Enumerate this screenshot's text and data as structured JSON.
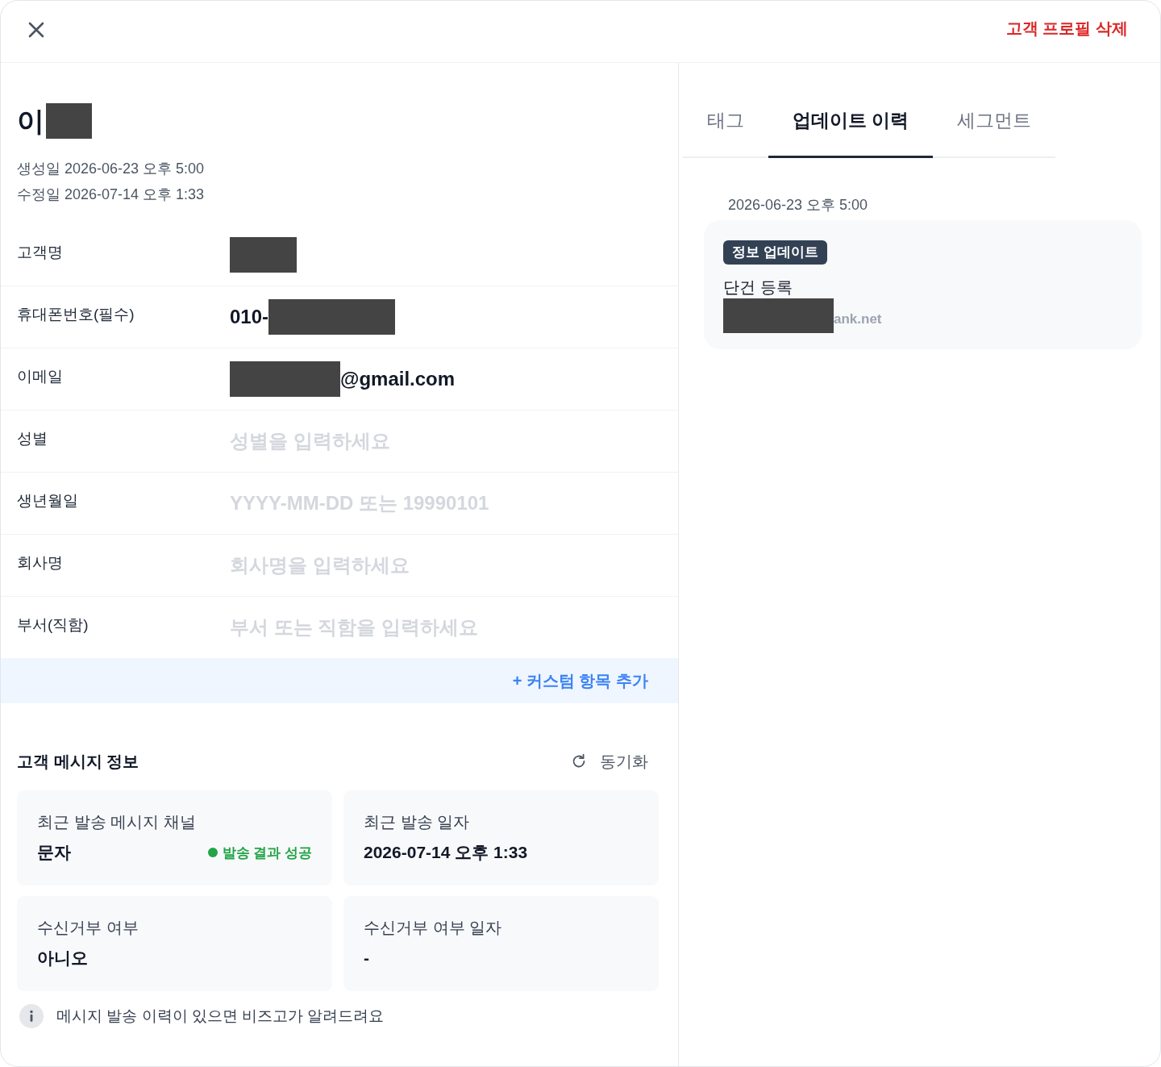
{
  "header": {
    "delete_button": "고객 프로필 삭제"
  },
  "profile": {
    "name": {
      "text": "이",
      "mask_before": false,
      "mask_after": true
    },
    "meta": [
      "생성일 2026-06-23 오후 5:00",
      "수정일 2026-07-14 오후 1:33"
    ]
  },
  "fields": [
    {
      "label": "고객명",
      "mask_before": true,
      "mask_after": false
    },
    {
      "label": "휴대폰번호(필수)",
      "value": "010-",
      "mask_before": false,
      "mask_after": true
    },
    {
      "label": "이메일",
      "value": "@gmail.com",
      "mask_before": true,
      "mask_after": false
    },
    {
      "label": "성별",
      "placeholder": "성별을 입력하세요",
      "mask_before": false,
      "mask_after": false
    },
    {
      "label": "생년월일",
      "placeholder": "YYYY-MM-DD 또는 19990101",
      "mask_before": false,
      "mask_after": false
    },
    {
      "label": "회사명",
      "placeholder": "회사명을 입력하세요",
      "mask_before": false,
      "mask_after": false
    },
    {
      "label": "부서(직함)",
      "placeholder": "부서 또는 직함을 입력하세요",
      "mask_before": false,
      "mask_after": false
    }
  ],
  "add_custom_button": "+ 커스텀 항목 추가",
  "message_info": {
    "title": "고객 메시지 정보",
    "sync_button": "동기화",
    "cards": [
      {
        "label": "최근 발송 메시지 채널",
        "value": "문자",
        "status": {
          "kind": "success",
          "text": "발송 결과 성공"
        }
      },
      {
        "label": "최근 발송 일자",
        "value": "2026-07-14 오후 1:33"
      },
      {
        "label": "수신거부 여부",
        "value": "아니오"
      },
      {
        "label": "수신거부 여부 일자",
        "value": "-"
      }
    ],
    "note": "메시지 발송 이력이 있으면 비즈고가 알려드려요"
  },
  "tabs": [
    {
      "label": "태그",
      "selected": false
    },
    {
      "label": "업데이트 이력",
      "selected": true
    },
    {
      "label": "세그먼트",
      "selected": false
    }
  ],
  "history": [
    {
      "date": "2026-06-23 오후 5:00",
      "badge": "정보 업데이트",
      "title": "단건 등록",
      "detail": {
        "text": "ank.net",
        "mask_before": true,
        "mask_after": false
      }
    }
  ]
}
